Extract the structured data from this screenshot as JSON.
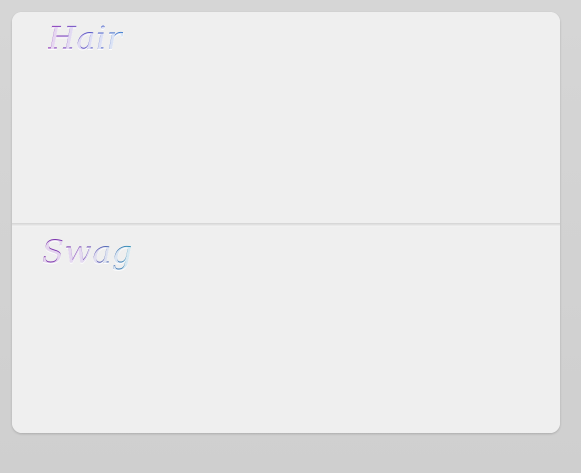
{
  "sections": [
    {
      "title": "Hair"
    },
    {
      "title": "Swag"
    }
  ]
}
